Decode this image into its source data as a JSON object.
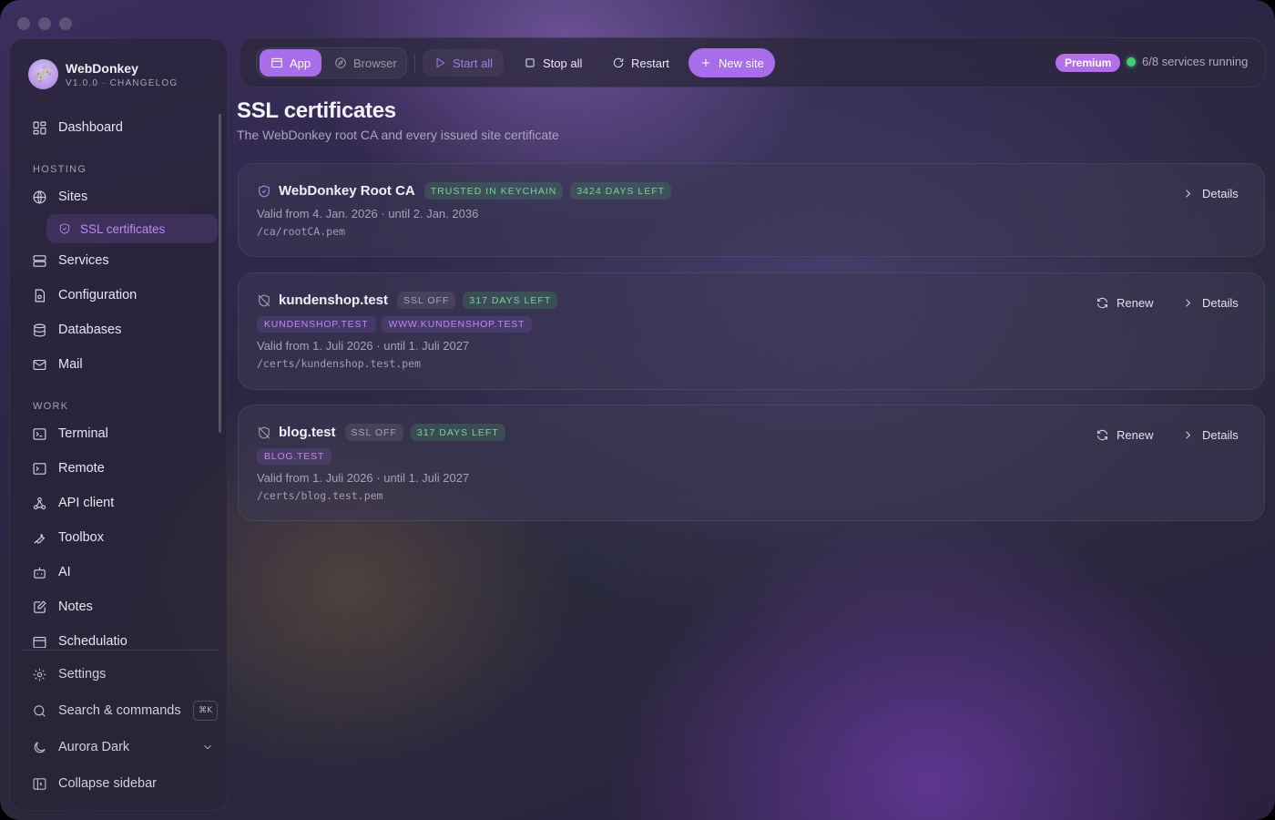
{
  "brand": {
    "name": "WebDonkey",
    "sub": "V1.0.0 · CHANGELOG"
  },
  "sidebar": {
    "dashboard": "Dashboard",
    "hosting_label": "HOSTING",
    "sites": "Sites",
    "ssl": "SSL certificates",
    "services": "Services",
    "configuration": "Configuration",
    "databases": "Databases",
    "mail": "Mail",
    "work_label": "WORK",
    "terminal": "Terminal",
    "remote": "Remote",
    "api_client": "API client",
    "toolbox": "Toolbox",
    "ai": "AI",
    "notes": "Notes",
    "next": "Schedulatio",
    "settings": "Settings",
    "search": "Search & commands",
    "search_kbd": "⌘K",
    "theme": "Aurora Dark",
    "collapse": "Collapse sidebar"
  },
  "toolbar": {
    "app": "App",
    "browser": "Browser",
    "start_all": "Start all",
    "stop_all": "Stop all",
    "restart": "Restart",
    "new_site": "New site",
    "premium": "Premium",
    "services_status": "6/8 services running"
  },
  "page": {
    "title": "SSL certificates",
    "subtitle": "The WebDonkey root CA and every issued site certificate"
  },
  "certs": [
    {
      "name": "WebDonkey Root CA",
      "badges": [
        "TRUSTED IN KEYCHAIN",
        "3424 DAYS LEFT"
      ],
      "domains": [],
      "valid": "Valid from 4. Jan. 2026 · until 2. Jan. 2036",
      "path": "/ca/rootCA.pem",
      "details": "Details"
    },
    {
      "name": "kundenshop.test",
      "badges": [
        "SSL OFF",
        "317 DAYS LEFT"
      ],
      "domains": [
        "KUNDENSHOP.TEST",
        "WWW.KUNDENSHOP.TEST"
      ],
      "valid": "Valid from 1. Juli 2026 · until 1. Juli 2027",
      "path": "/certs/kundenshop.test.pem",
      "renew": "Renew",
      "details": "Details"
    },
    {
      "name": "blog.test",
      "badges": [
        "SSL OFF",
        "317 DAYS LEFT"
      ],
      "domains": [
        "BLOG.TEST"
      ],
      "valid": "Valid from 1. Juli 2026 · until 1. Juli 2027",
      "path": "/certs/blog.test.pem",
      "renew": "Renew",
      "details": "Details"
    }
  ],
  "colors": {
    "accent": "#a86de8",
    "success": "#3fcf72",
    "badge_green": "#76d49a"
  }
}
